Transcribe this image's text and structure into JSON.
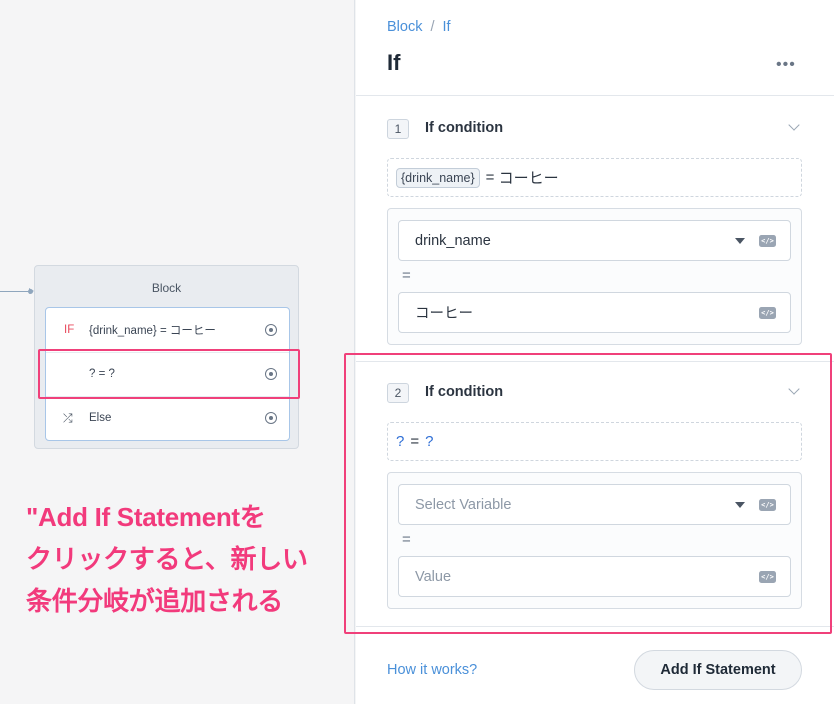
{
  "canvas": {
    "block": {
      "title": "Block",
      "rows": [
        {
          "tag": "IF",
          "text": "{drink_name} = コーヒー"
        },
        {
          "tag": "",
          "text": "? = ?"
        },
        {
          "tag": "shuffle-icon",
          "text": "Else"
        }
      ]
    },
    "annotation": {
      "lines": [
        "\"Add If Statementを",
        "クリックすると、新しい",
        "条件分岐が追加される"
      ],
      "color": "#f23a7c"
    }
  },
  "panel": {
    "breadcrumb": {
      "root": "Block",
      "separator": "/",
      "current": "If"
    },
    "title": "If",
    "more_icon": "more-horizontal-icon",
    "conditions": [
      {
        "number": "1",
        "label": "If condition",
        "summary": {
          "variable": "{drink_name}",
          "operator": "=",
          "value": "コーヒー"
        },
        "variable_field": {
          "value": "drink_name",
          "placeholder": "Select Variable"
        },
        "operator": "=",
        "value_field": {
          "value": "コーヒー",
          "placeholder": "Value"
        }
      },
      {
        "number": "2",
        "label": "If condition",
        "summary": {
          "variable": "?",
          "operator": "=",
          "value": "?"
        },
        "variable_field": {
          "value": "",
          "placeholder": "Select Variable"
        },
        "operator": "=",
        "value_field": {
          "value": "",
          "placeholder": "Value"
        }
      }
    ],
    "footer": {
      "how_link": "How it works?",
      "add_button": "Add If Statement"
    }
  },
  "colors": {
    "accent": "#4a90d9",
    "highlight": "#f0407a",
    "if_tag": "#e8495c"
  }
}
